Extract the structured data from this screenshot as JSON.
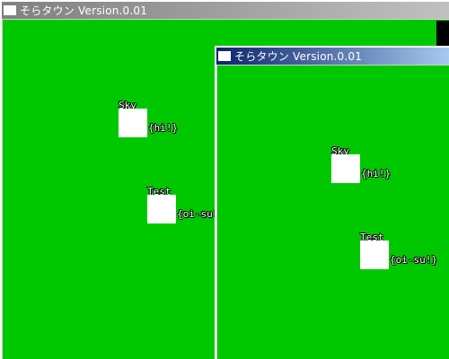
{
  "back_window": {
    "title": "そらタウン Version.0.01",
    "characters": [
      {
        "name": "Sky",
        "speech": "{hi!}"
      },
      {
        "name": "Test",
        "speech": "{oi-su!}"
      }
    ]
  },
  "front_window": {
    "title": "そらタウン Version.0.01",
    "characters": [
      {
        "name": "Sky",
        "speech": "{hi!}"
      },
      {
        "name": "Test",
        "speech": "{oi-su!}"
      }
    ]
  },
  "colors": {
    "field": "#00c800",
    "active_title": "#0a246a",
    "inactive_title": "#808080",
    "avatar": "#ffffff"
  },
  "icons": {
    "window_icon": "window-icon"
  }
}
